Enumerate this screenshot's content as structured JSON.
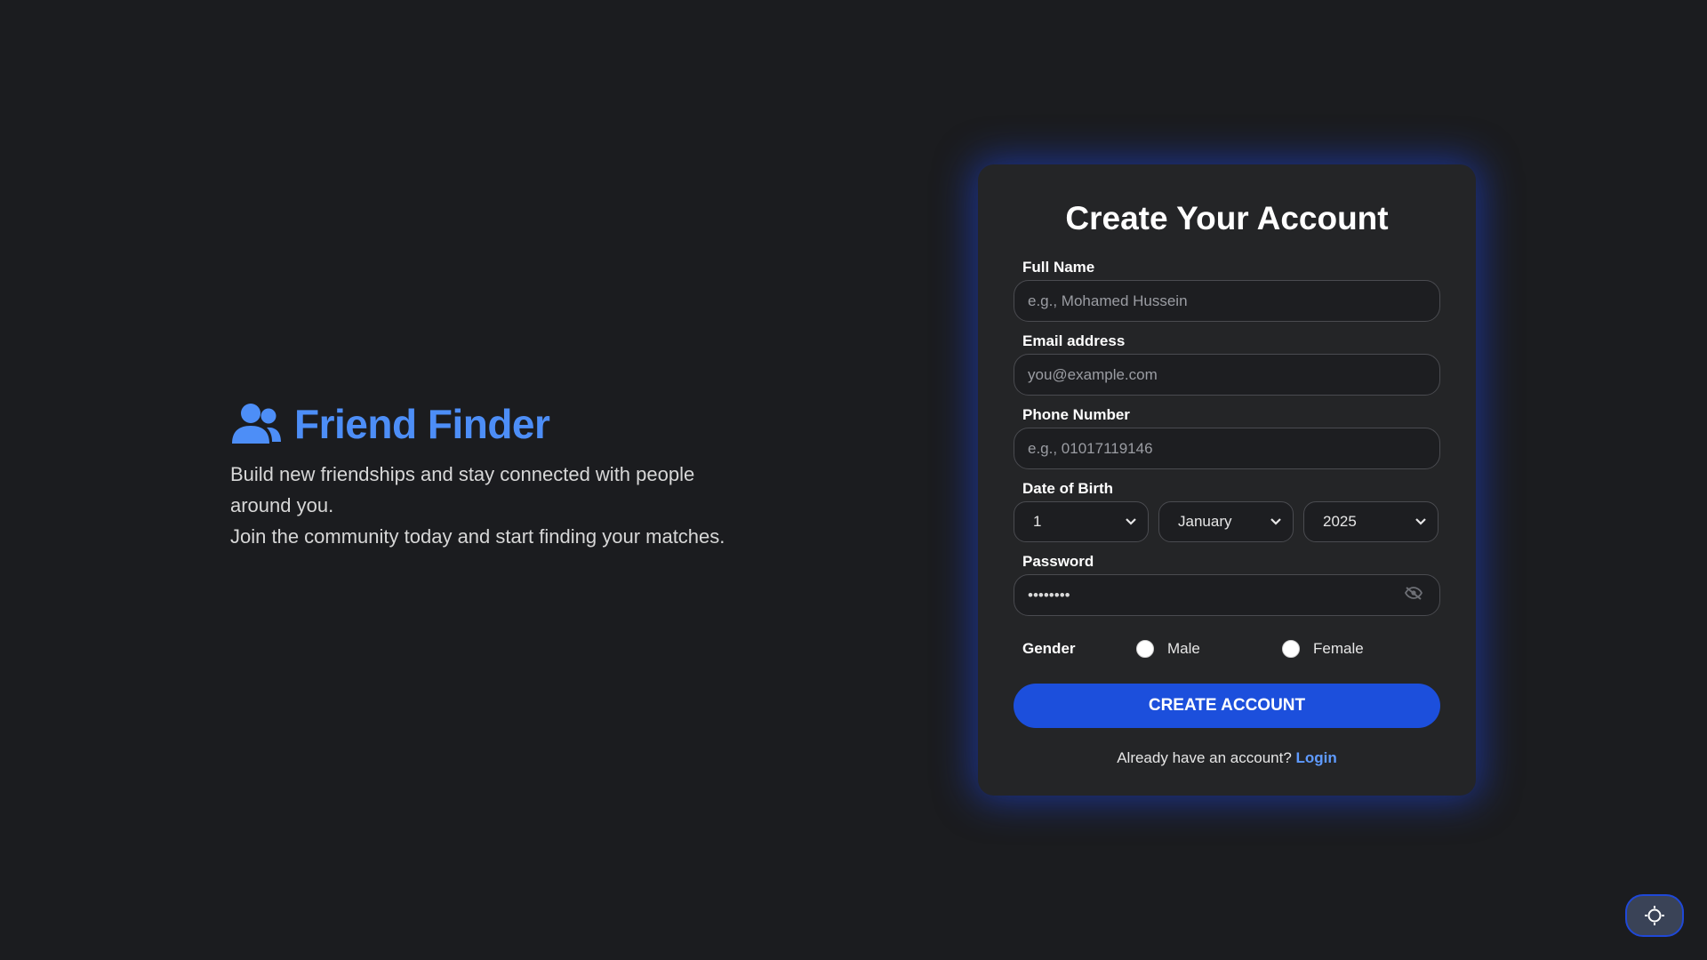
{
  "brand": {
    "title": "Friend Finder",
    "tagline_line1": "Build new friendships and stay connected with people around you.",
    "tagline_line2": "Join the community today and start finding your matches.",
    "icon": "users-icon",
    "accent_color": "#4d8ef7"
  },
  "form": {
    "title": "Create Your Account",
    "full_name": {
      "label": "Full Name",
      "placeholder": "e.g., Mohamed Hussein"
    },
    "email": {
      "label": "Email address",
      "placeholder": "you@example.com"
    },
    "phone": {
      "label": "Phone Number",
      "placeholder": "e.g., 01017119146"
    },
    "dob": {
      "label": "Date of Birth",
      "day": "1",
      "month": "January",
      "year": "2025"
    },
    "password": {
      "label": "Password",
      "value": "••••••••",
      "toggle_icon": "eye-slash-icon"
    },
    "gender": {
      "label": "Gender",
      "options": [
        "Male",
        "Female"
      ]
    },
    "submit_label": "CREATE ACCOUNT",
    "login_prompt": "Already have an account?",
    "login_link": "Login",
    "button_color": "#1c4fdc"
  },
  "theme_toggle": {
    "icon": "sun-icon"
  }
}
